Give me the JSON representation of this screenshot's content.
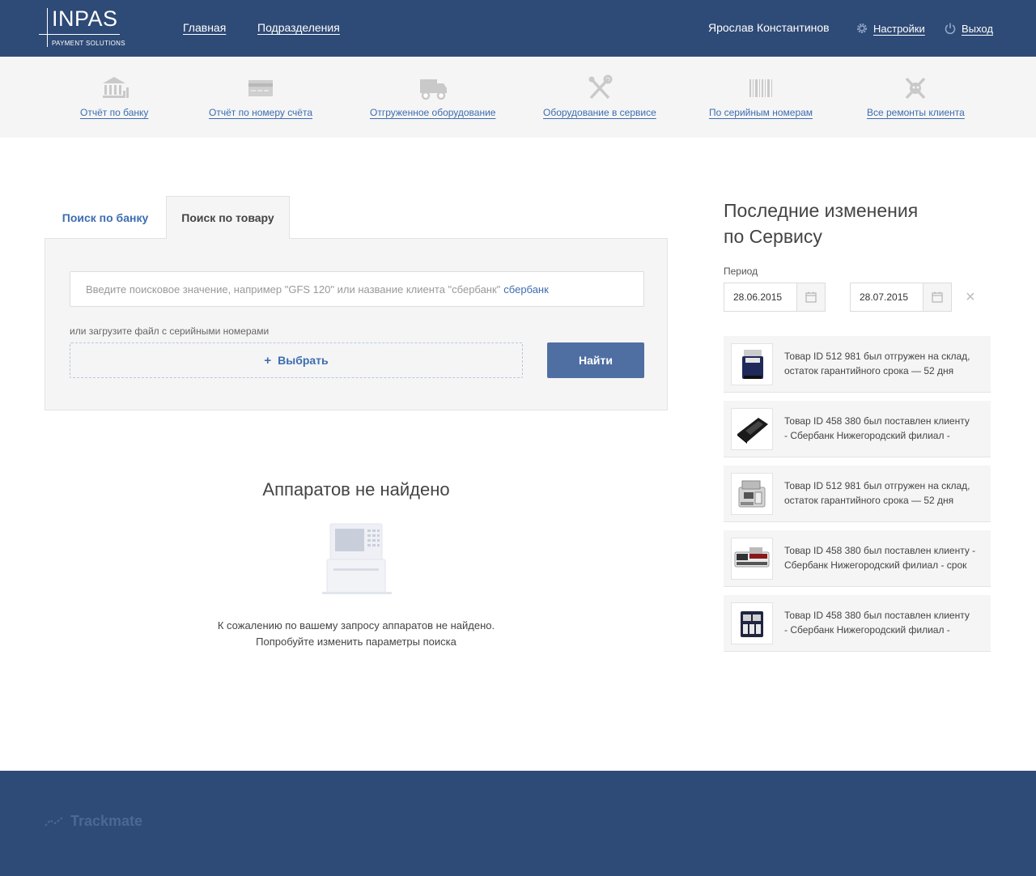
{
  "header": {
    "logo_text": "INPAS",
    "logo_sub": "PAYMENT SOLUTIONS",
    "nav": [
      {
        "label": "Главная"
      },
      {
        "label": "Подразделения"
      }
    ],
    "user_name": "Ярослав Константинов",
    "settings_label": "Настройки",
    "logout_label": "Выход"
  },
  "toolbar": {
    "items": [
      {
        "label": "Отчёт по банку",
        "icon": "bank-icon"
      },
      {
        "label": "Отчёт по номеру счёта",
        "icon": "card-icon"
      },
      {
        "label": "Отгруженное оборудование",
        "icon": "truck-icon"
      },
      {
        "label": "Оборудование в сервисе",
        "icon": "tools-icon"
      },
      {
        "label": "По серийным номерам",
        "icon": "barcode-icon"
      },
      {
        "label": "Все ремонты клиента",
        "icon": "repair-icon"
      }
    ]
  },
  "search": {
    "tabs": [
      {
        "label": "Поиск по банку",
        "active": false
      },
      {
        "label": "Поиск по товару",
        "active": true
      }
    ],
    "placeholder": "Введите поисковое значение, например \"GFS 120\" или название клиента \"сбербанк\"",
    "placeholder_link": "сбербанк",
    "upload_hint": "или загрузите файл с серийными номерами",
    "choose_plus": "+",
    "choose_label": "Выбрать",
    "find_label": "Найти"
  },
  "empty": {
    "title": "Аппаратов не найдено",
    "line1": "К сожалению по вашему запросу аппаратов не найдено.",
    "line2": "Попробуйте изменить параметры поиска"
  },
  "sidebar": {
    "title_line1": "Последние изменения",
    "title_line2": "по Сервису",
    "period_label": "Период",
    "date_from": "28.06.2015",
    "date_to": "28.07.2015",
    "clear": "×",
    "feed": [
      {
        "line1": "Товар ID 512 981 был отгружен на склад,",
        "line2": "остаток гарантийного срока — 52 дня",
        "thumb": "counter-device-icon"
      },
      {
        "line1": "Товар ID 458 380 был поставлен клиенту",
        "line2": "- Сбербанк Нижегородский филиал -",
        "thumb": "terminal-device-icon"
      },
      {
        "line1": "Товар ID 512 981 был отгружен на склад,",
        "line2": "остаток гарантийного срока — 52 дня",
        "thumb": "sorter-device-icon"
      },
      {
        "line1": "Товар ID 458 380 был поставлен клиенту -",
        "line2": "Сбербанк Нижегородский филиал - срок",
        "thumb": "detector-device-icon"
      },
      {
        "line1": "Товар ID 458 380 был поставлен клиенту",
        "line2": "- Сбербанк Нижегородский филиал -",
        "thumb": "multipocket-device-icon"
      }
    ]
  },
  "footer": {
    "brand": "Trackmate"
  }
}
